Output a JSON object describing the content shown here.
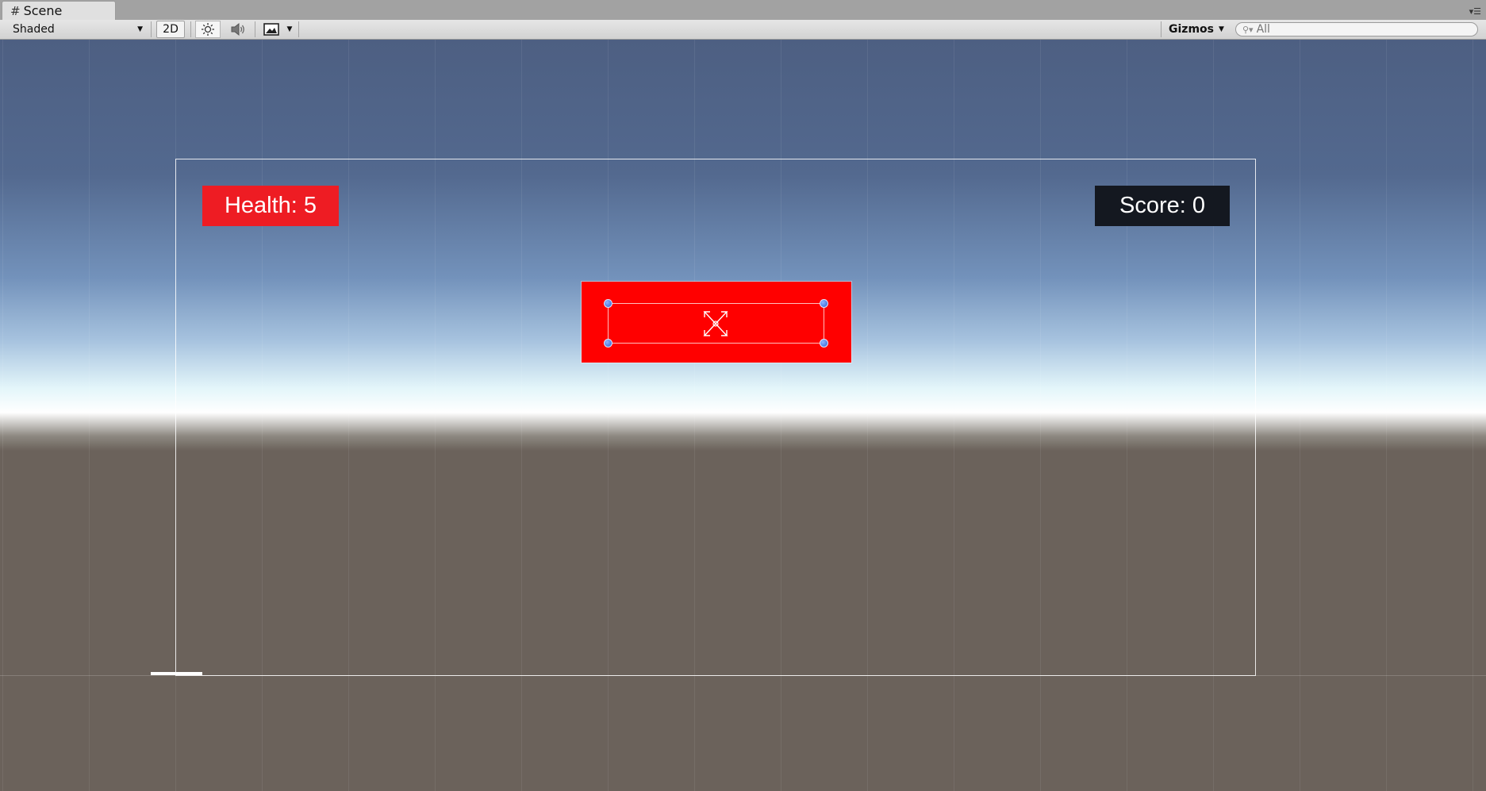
{
  "tab": {
    "title": "Scene",
    "icon": "hash-icon"
  },
  "toolbar": {
    "draw_mode": "Shaded",
    "mode_2d": "2D",
    "gizmos_label": "Gizmos",
    "search_placeholder": "All"
  },
  "scene": {
    "health_text": "Health: 5",
    "score_text": "Score: 0",
    "health_color": "#ee1c23",
    "score_color": "#141820",
    "panel_color": "#ff0000"
  }
}
